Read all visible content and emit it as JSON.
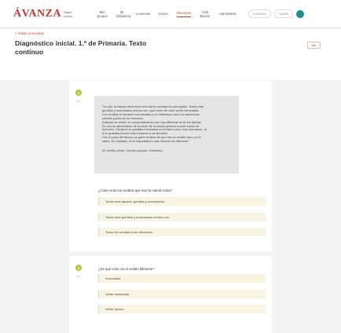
{
  "header": {
    "logo": "ÁVANZA",
    "logo_sub": "Santo Lector",
    "nav": [
      {
        "label": "Mis grupos"
      },
      {
        "label": "Mi biblioteca"
      },
      {
        "label": "Licencias"
      },
      {
        "label": "Libros"
      },
      {
        "label": "Recursos"
      },
      {
        "label": "Club Beedo"
      },
      {
        "label": "Administrar"
      }
    ],
    "pills": [
      "Contacto",
      "Ayuda"
    ]
  },
  "subheader": {
    "back_link": "< Volver a recursos",
    "title": "Diagnóstico inicial. 1.º de Primaria. Texto continuo",
    "action_button": "Ver"
  },
  "questions": [
    {
      "number": "1",
      "subnumber": "001",
      "text_lines": [
        "\"Un día, la mamá cerda tuvo una nueva camada de puerquitos. Todos eran",
        "gorditos y sonrosados menos uno, que nació de color verde esmeralda.",
        "Los cerditos lo miraron horrorizados y no entendían cómo un animal tan",
        "extraño podía ser su hermano.",
        "Además de verde, su comportamiento era muy diferente al de los demás.",
        "En vez de alimentarse de la leche de la madre prefería comer trozos de",
        "bizcocho. Tampoco le gustaba revolcarse en el barro como sus hermanos. ¡A",
        "él le gustaba mucho más treparse a los árboles!",
        "Con el paso del tiempo se ganó la fama de que era un cerdito raro y el lo",
        "sabía. En realidad, no le importaba lo más mínimo ser diferente.\""
      ],
      "source": "(El cerdito verde. Cuento popular. Colombia)",
      "prompt": "¿Cómo eran los cerditos que tuvo la mamá cerda?",
      "options": [
        "Todos eran iguales: gorditos y sonrosados.",
        "Todos eran gorditos y sonrosados menos uno.",
        "Todos los cerditos eran diferentes."
      ]
    },
    {
      "number": "2",
      "subnumber": "001",
      "prompt": "¿De qué color era el cerdito diferente?",
      "options": [
        "Sonrosado",
        "Verde esmeralda",
        "Verde oscuro"
      ]
    }
  ],
  "colors": {
    "brand_red": "#c0392b",
    "badge_green": "#b8c43b",
    "option_bg": "#f7f5e2",
    "avatar_teal": "#1a8f8f"
  }
}
